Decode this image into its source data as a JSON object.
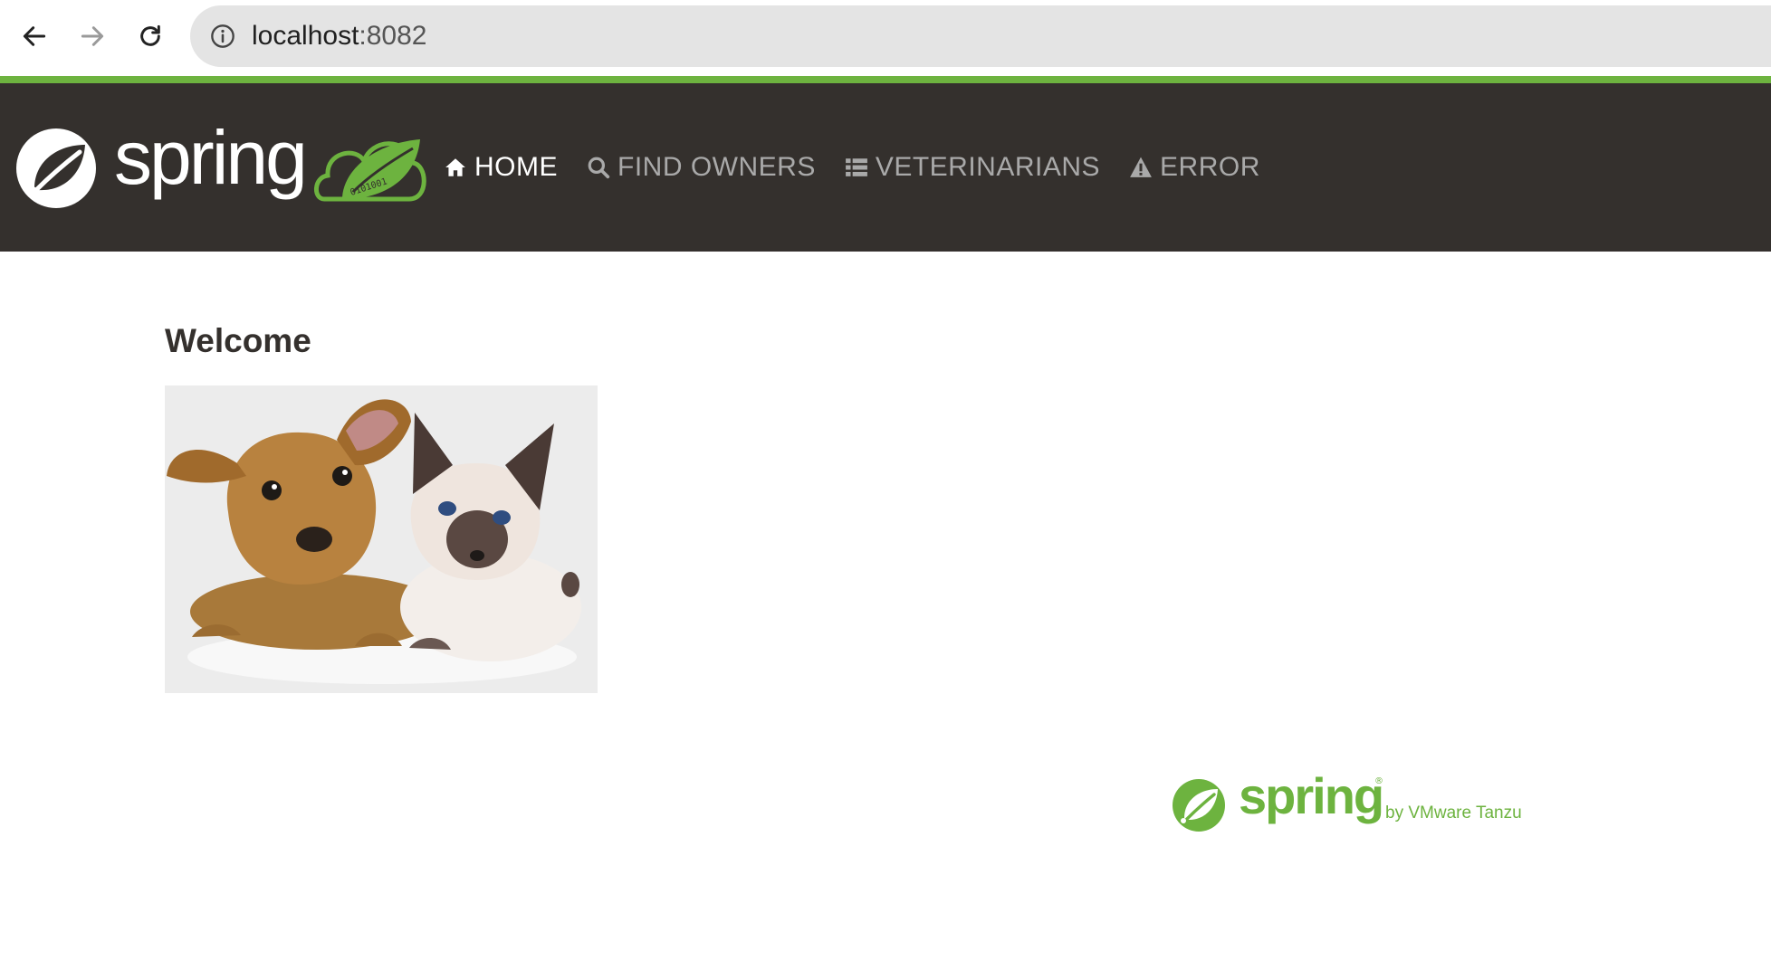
{
  "browser": {
    "url_host": "localhost",
    "url_port": ":8082",
    "icons": [
      "back-arrow-icon",
      "forward-arrow-icon",
      "reload-icon",
      "info-icon"
    ]
  },
  "navbar": {
    "brand_word": "spring",
    "brand_cloud_text": "0101001",
    "items": [
      {
        "label": "HOME",
        "icon": "home-icon",
        "active": true
      },
      {
        "label": "FIND OWNERS",
        "icon": "search-icon",
        "active": false
      },
      {
        "label": "VETERINARIANS",
        "icon": "list-icon",
        "active": false
      },
      {
        "label": "ERROR",
        "icon": "warning-icon",
        "active": false
      }
    ]
  },
  "main": {
    "title": "Welcome"
  },
  "footer": {
    "logo_word": "spring",
    "logo_reg": "®",
    "logo_byline": "by VMware Tanzu"
  },
  "colors": {
    "spring_green": "#6db33f",
    "navbar_bg": "#34302d",
    "nav_active": "#ffffff",
    "nav_inactive": "#a9a9a9"
  }
}
